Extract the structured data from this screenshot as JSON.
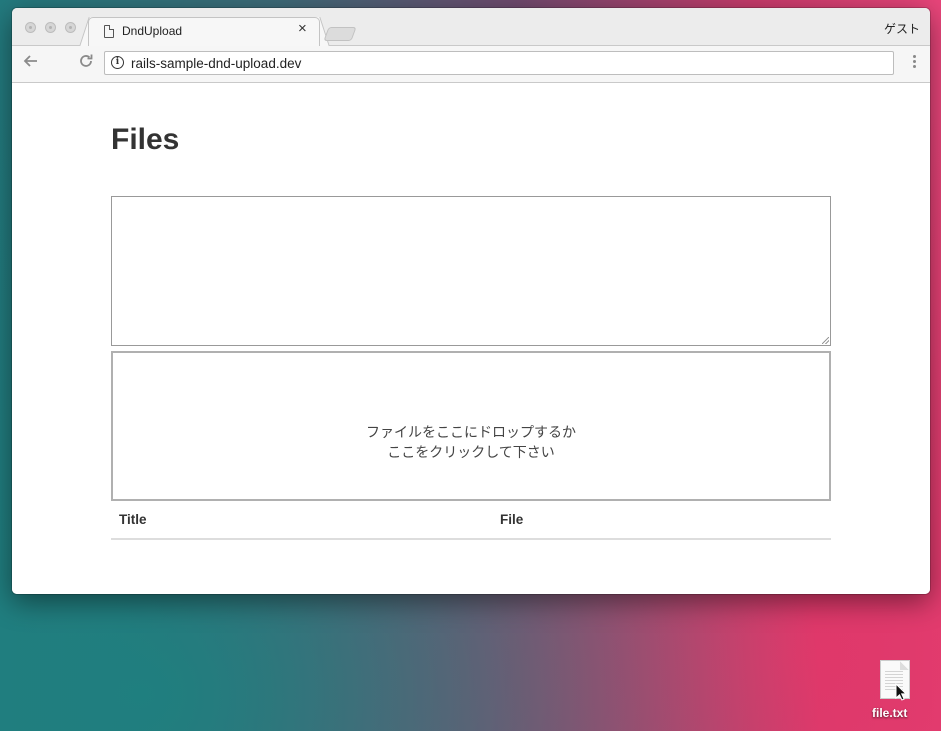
{
  "browser": {
    "tab_title": "DndUpload",
    "tab_close": "×",
    "user_label": "ゲスト",
    "url": "rails-sample-dnd-upload.dev",
    "back_icon": "arrow-left-icon",
    "reload_icon": "reload-icon",
    "info_icon": "info-icon"
  },
  "page": {
    "heading": "Files",
    "dropzone_line1": "ファイルをここにドロップするか",
    "dropzone_line2": "ここをクリックして下さい",
    "table": {
      "columns": [
        "Title",
        "File"
      ]
    }
  },
  "desktop": {
    "file_name": "file.txt"
  }
}
